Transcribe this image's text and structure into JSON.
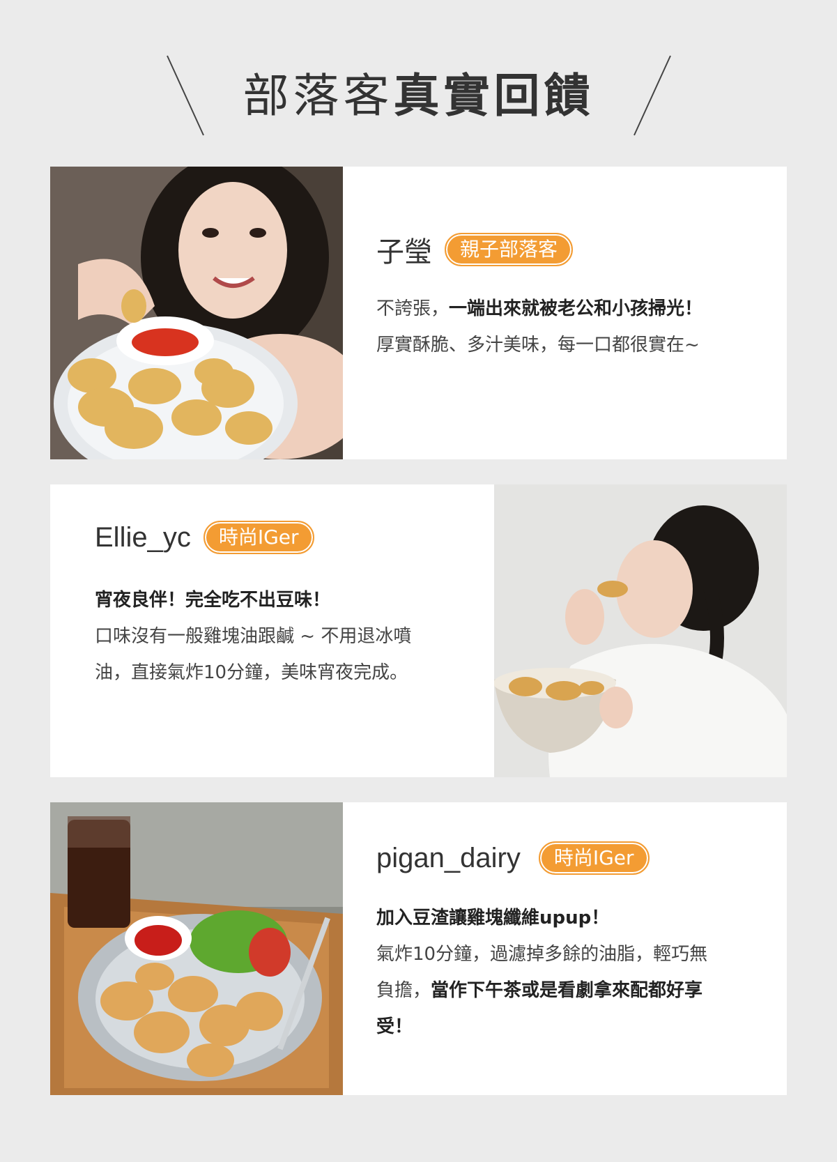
{
  "header": {
    "title_light": "部落客",
    "title_bold": "真實回饋"
  },
  "accent_color": "#f39c33",
  "reviews": [
    {
      "name": "子瑩",
      "badge": "親子部落客",
      "line1_a": "不誇張，",
      "line1_b": "一端出來就被老公和小孩掃光！",
      "line2": "厚實酥脆、多汁美味，每一口都很實在~",
      "photo": "selfie-eating-nuggets-icon"
    },
    {
      "name": "Ellie_yc",
      "badge": "時尚IGer",
      "line1": "宵夜良伴！完全吃不出豆味！",
      "line2": "口味沒有一般雞塊油跟鹹 ~ 不用退冰噴",
      "line3": "油，直接氣炸10分鐘，美味宵夜完成。",
      "photo": "woman-eating-nugget-icon"
    },
    {
      "name": "pigan_dairy",
      "badge": "時尚IGer",
      "line1": "加入豆渣讓雞塊纖維upup！",
      "line2": "氣炸10分鐘，過濾掉多餘的油脂，輕巧無",
      "line3_a": "負擔，",
      "line3_b": "當作下午茶或是看劇拿來配都好享",
      "line4": "受！",
      "photo": "nugget-tray-icon"
    }
  ]
}
